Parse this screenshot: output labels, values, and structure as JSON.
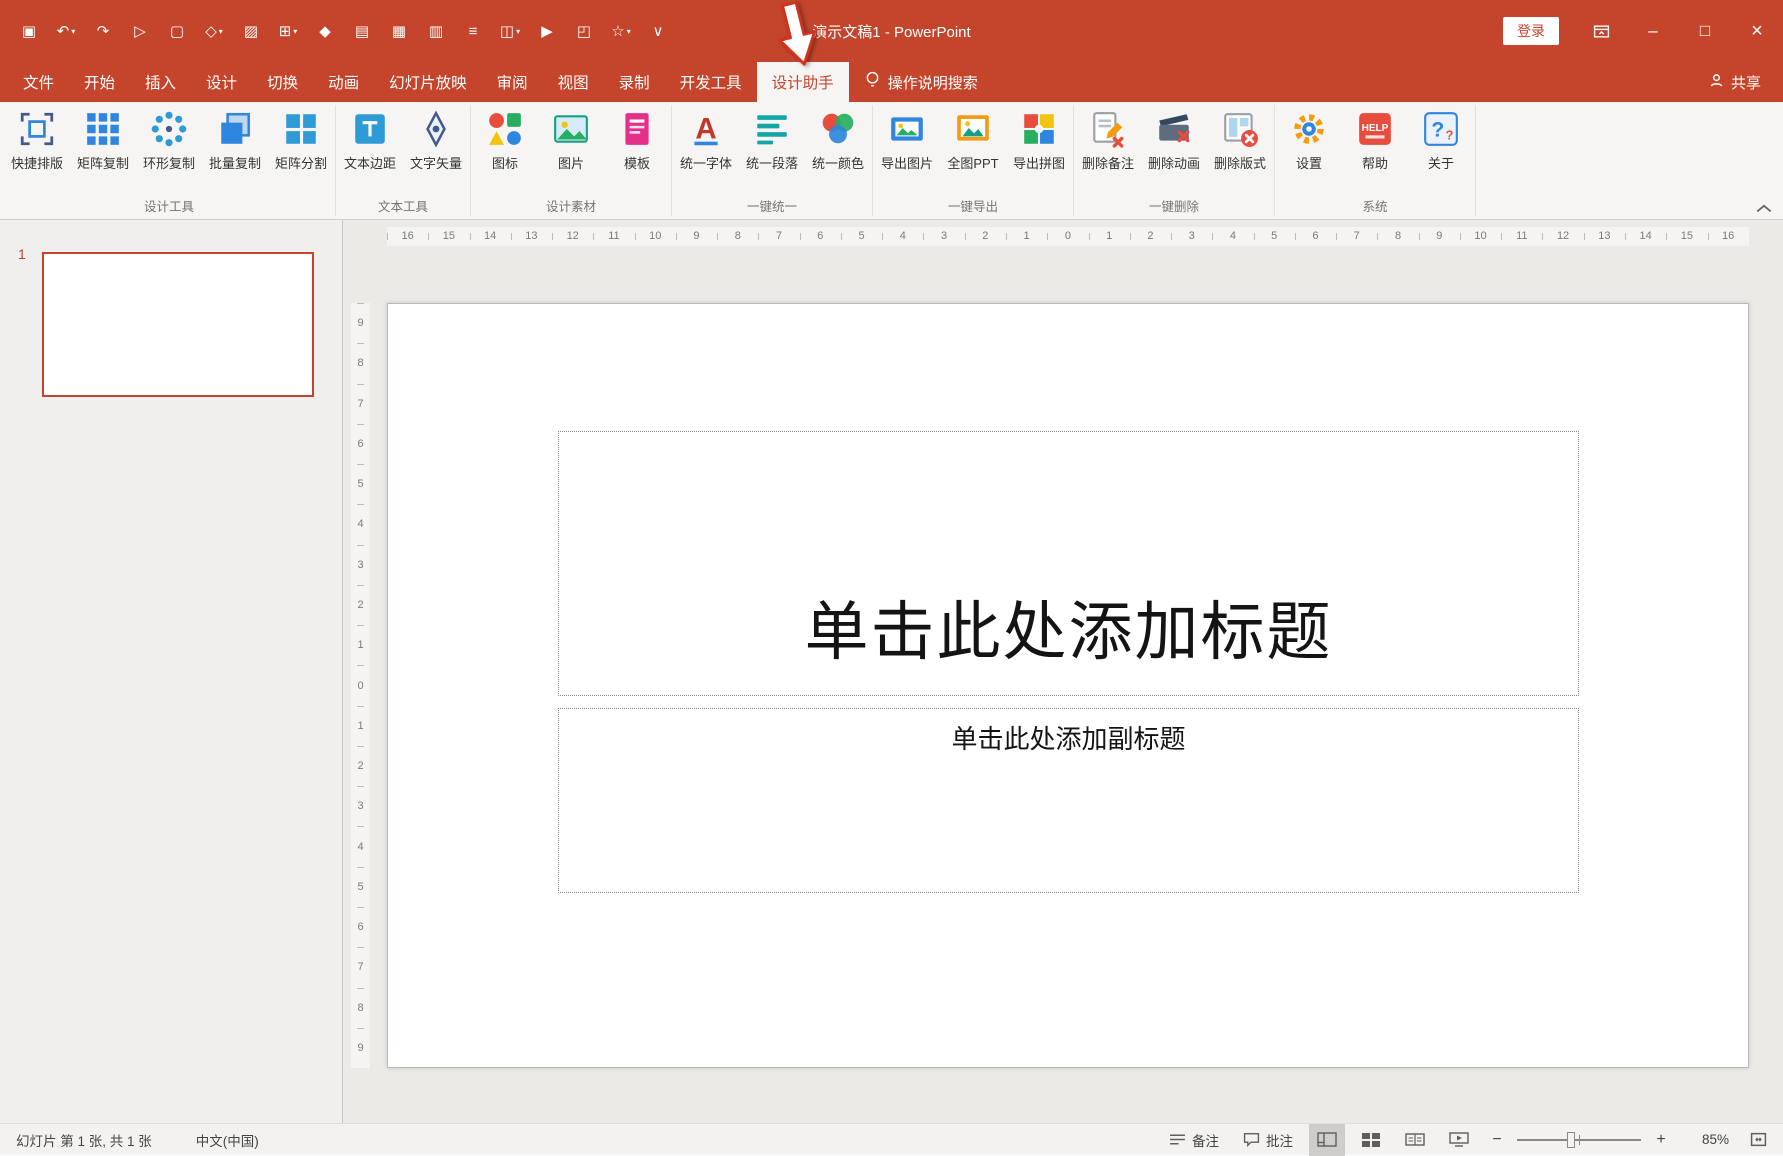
{
  "colors": {
    "brand": "#C5452C"
  },
  "titlebar": {
    "title": "演示文稿1 - PowerPoint",
    "login_label": "登录",
    "minimize_glyph": "–",
    "maximize_glyph": "□",
    "close_glyph": "×",
    "qat_icons": [
      {
        "name": "save-icon",
        "glyph": "▣"
      },
      {
        "name": "undo-icon",
        "glyph": "↶",
        "caret": true
      },
      {
        "name": "redo-icon",
        "glyph": "↷"
      },
      {
        "name": "start-slideshow-icon",
        "glyph": "▷"
      },
      {
        "name": "new-file-icon",
        "glyph": "▢"
      },
      {
        "name": "shapes-icon",
        "glyph": "◇",
        "caret": true
      },
      {
        "name": "format-painter-icon",
        "glyph": "▨"
      },
      {
        "name": "connector-icon",
        "glyph": "⊞",
        "caret": true
      },
      {
        "name": "brush-icon",
        "glyph": "◆"
      },
      {
        "name": "cut-icon",
        "glyph": "▤"
      },
      {
        "name": "table-icon",
        "glyph": "▦"
      },
      {
        "name": "chart-icon",
        "glyph": "▥"
      },
      {
        "name": "text-box-icon",
        "glyph": "≡"
      },
      {
        "name": "columns-icon",
        "glyph": "◫",
        "caret": true
      },
      {
        "name": "slideshow-icon",
        "glyph": "▶"
      },
      {
        "name": "folder-icon",
        "glyph": "◰"
      },
      {
        "name": "star-icon",
        "glyph": "☆",
        "caret": true
      },
      {
        "name": "customize-qat-icon",
        "glyph": "∨"
      }
    ]
  },
  "tabbar": {
    "search_label": "操作说明搜索",
    "share_label": "共享",
    "tabs": [
      {
        "name": "file",
        "label": "文件"
      },
      {
        "name": "home",
        "label": "开始"
      },
      {
        "name": "insert",
        "label": "插入"
      },
      {
        "name": "design",
        "label": "设计"
      },
      {
        "name": "transitions",
        "label": "切换"
      },
      {
        "name": "animations",
        "label": "动画"
      },
      {
        "name": "slideshow",
        "label": "幻灯片放映"
      },
      {
        "name": "review",
        "label": "审阅"
      },
      {
        "name": "view",
        "label": "视图"
      },
      {
        "name": "record",
        "label": "录制"
      },
      {
        "name": "developer",
        "label": "开发工具"
      },
      {
        "name": "design-assistant",
        "label": "设计助手",
        "active": true
      }
    ]
  },
  "ribbon": {
    "groups": [
      {
        "name": "设计工具",
        "buttons": [
          {
            "label": "快捷排版",
            "icon": "quick-layout"
          },
          {
            "label": "矩阵复制",
            "icon": "matrix-copy"
          },
          {
            "label": "环形复制",
            "icon": "ring-copy"
          },
          {
            "label": "批量复制",
            "icon": "batch-copy"
          },
          {
            "label": "矩阵分割",
            "icon": "matrix-split"
          }
        ]
      },
      {
        "name": "文本工具",
        "buttons": [
          {
            "label": "文本边距",
            "icon": "text-margin"
          },
          {
            "label": "文字矢量",
            "icon": "text-vector"
          }
        ]
      },
      {
        "name": "设计素材",
        "buttons": [
          {
            "label": "图标",
            "icon": "icon-lib"
          },
          {
            "label": "图片",
            "icon": "picture"
          },
          {
            "label": "模板",
            "icon": "template"
          }
        ]
      },
      {
        "name": "一键统一",
        "buttons": [
          {
            "label": "统一字体",
            "icon": "unify-font"
          },
          {
            "label": "统一段落",
            "icon": "unify-para"
          },
          {
            "label": "统一颜色",
            "icon": "unify-color"
          }
        ]
      },
      {
        "name": "一键导出",
        "buttons": [
          {
            "label": "导出图片",
            "icon": "export-image"
          },
          {
            "label": "全图PPT",
            "icon": "full-ppt"
          },
          {
            "label": "导出拼图",
            "icon": "export-puzzle"
          }
        ]
      },
      {
        "name": "一键删除",
        "buttons": [
          {
            "label": "删除备注",
            "icon": "delete-note"
          },
          {
            "label": "删除动画",
            "icon": "delete-anim"
          },
          {
            "label": "删除版式",
            "icon": "delete-layout"
          }
        ]
      },
      {
        "name": "系统",
        "buttons": [
          {
            "label": "设置",
            "icon": "settings"
          },
          {
            "label": "帮助",
            "icon": "help"
          },
          {
            "label": "关于",
            "icon": "about"
          }
        ]
      }
    ]
  },
  "slides_panel": {
    "number": "1"
  },
  "slide": {
    "title_placeholder": "单击此处添加标题",
    "subtitle_placeholder": "单击此处添加副标题"
  },
  "ruler": {
    "h_numbers": [
      "16",
      "15",
      "14",
      "13",
      "12",
      "11",
      "10",
      "9",
      "8",
      "7",
      "6",
      "5",
      "4",
      "3",
      "2",
      "1",
      "0",
      "1",
      "2",
      "3",
      "4",
      "5",
      "6",
      "7",
      "8",
      "9",
      "10",
      "11",
      "12",
      "13",
      "14",
      "15",
      "16"
    ],
    "v_numbers": [
      "9",
      "8",
      "7",
      "6",
      "5",
      "4",
      "3",
      "2",
      "1",
      "0",
      "1",
      "2",
      "3",
      "4",
      "5",
      "6",
      "7",
      "8",
      "9"
    ]
  },
  "statusbar": {
    "slide_info": "幻灯片 第 1 张, 共 1 张",
    "language": "中文(中国)",
    "notes_label": "备注",
    "comments_label": "批注",
    "zoom_out_glyph": "−",
    "zoom_in_glyph": "+",
    "zoom_level": "85%"
  }
}
